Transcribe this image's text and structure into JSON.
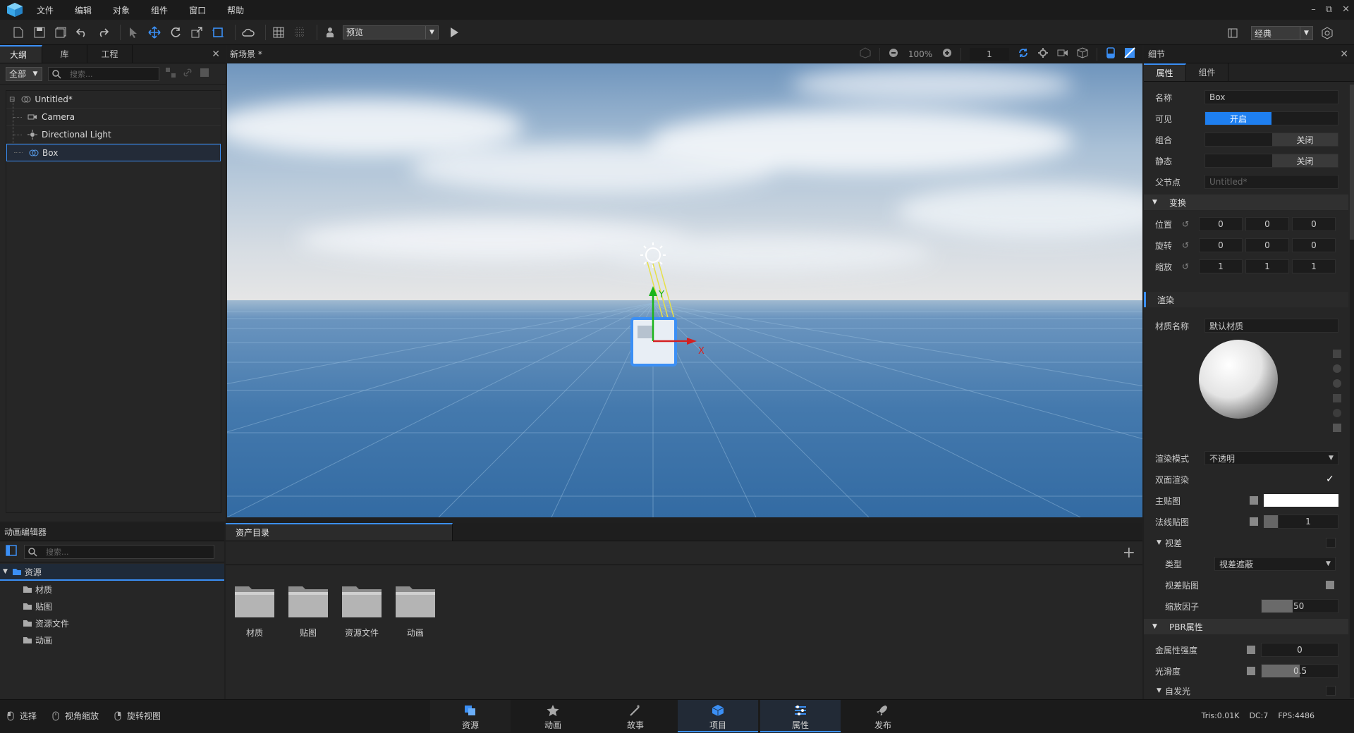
{
  "menubar": {
    "items": [
      "文件",
      "编辑",
      "对象",
      "组件",
      "窗口",
      "帮助"
    ],
    "window_controls": [
      "–",
      "⧉",
      "✕"
    ]
  },
  "toolbar": {
    "preview_label": "预览",
    "layout_label": "经典"
  },
  "left_panel": {
    "tabs": [
      "大纲",
      "库",
      "工程"
    ],
    "filter": "全部",
    "search_placeholder": "搜索...",
    "tree": [
      {
        "label": "Untitled*",
        "icon": "scene-icon"
      },
      {
        "label": "Camera",
        "icon": "camera-icon"
      },
      {
        "label": "Directional Light",
        "icon": "light-icon"
      },
      {
        "label": "Box",
        "icon": "mesh-icon"
      }
    ]
  },
  "viewport": {
    "title": "新场景 *",
    "zoom": "100%",
    "grid_value": "1",
    "axis_x": "X",
    "axis_y": "Y"
  },
  "right_panel": {
    "title": "细节",
    "tabs": [
      "属性",
      "组件"
    ],
    "name_label": "名称",
    "name_value": "Box",
    "visible_label": "可见",
    "visible_value": "开启",
    "group_label": "组合",
    "group_value": "关闭",
    "static_label": "静态",
    "static_value": "关闭",
    "parent_label": "父节点",
    "parent_value": "Untitled*",
    "transform_title": "变换",
    "position_label": "位置",
    "position": [
      "0",
      "0",
      "0"
    ],
    "rotation_label": "旋转",
    "rotation": [
      "0",
      "0",
      "0"
    ],
    "scale_label": "缩放",
    "scale": [
      "1",
      "1",
      "1"
    ],
    "render_title": "渲染",
    "material_label": "材质名称",
    "material_value": "默认材质",
    "render_mode_label": "渲染模式",
    "render_mode_value": "不透明",
    "double_side_label": "双面渲染",
    "main_tex_label": "主贴图",
    "normal_tex_label": "法线贴图",
    "normal_value": "1",
    "parallax_label": "视差",
    "type_label": "类型",
    "type_value": "视差遮蔽",
    "parallax_tex_label": "视差贴图",
    "scale_factor_label": "缩放因子",
    "scale_factor_value": "50",
    "pbr_title": "PBR属性",
    "metal_label": "金属性强度",
    "metal_value": "0",
    "smooth_label": "光滑度",
    "smooth_value": "0.5",
    "emission_label": "自发光"
  },
  "bottom_left": {
    "title": "动画编辑器",
    "search_placeholder": "搜索...",
    "root": "资源",
    "children": [
      "材质",
      "贴图",
      "资源文件",
      "动画"
    ]
  },
  "bottom_center": {
    "title": "资产目录",
    "folders": [
      "材质",
      "贴图",
      "资源文件",
      "动画"
    ]
  },
  "statusbar": {
    "tools": [
      "选择",
      "视角缩放",
      "旋转视图"
    ],
    "tabs": [
      "资源",
      "动画",
      "故事",
      "项目",
      "属性",
      "发布"
    ],
    "tris": "Tris:0.01K",
    "dc": "DC:7",
    "fps": "FPS:4486"
  },
  "colors": {
    "accent": "#3b8ff5",
    "toggle_on": "#1e7ff0",
    "sky_top": "#7fa3c9",
    "sea": "#3d74a8"
  }
}
